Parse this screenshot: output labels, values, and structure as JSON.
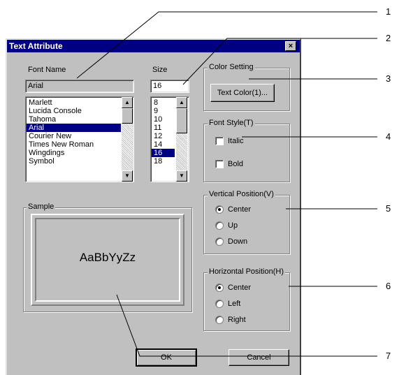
{
  "dialog": {
    "title": "Text Attribute",
    "close_glyph": "×"
  },
  "font_name": {
    "label": "Font Name",
    "value": "Arial",
    "items": [
      "Marlett",
      "Lucida Console",
      "Tahoma",
      "Arial",
      "Courier New",
      "Times New Roman",
      "Wingdings",
      "Symbol"
    ],
    "selected": "Arial"
  },
  "size": {
    "label": "Size",
    "value": "16",
    "items": [
      "8",
      "9",
      "10",
      "11",
      "12",
      "14",
      "16",
      "18"
    ],
    "selected": "16"
  },
  "color_setting": {
    "title": "Color Setting",
    "button_label": "Text Color(1)..."
  },
  "font_style": {
    "title": "Font Style(T)",
    "italic_label": "Italic",
    "bold_label": "Bold",
    "italic_checked": false,
    "bold_checked": false
  },
  "vertical_position": {
    "title": "Vertical Position(V)",
    "options": [
      "Center",
      "Up",
      "Down"
    ],
    "selected": "Center"
  },
  "horizontal_position": {
    "title": "Horizontal Position(H)",
    "options": [
      "Center",
      "Left",
      "Right"
    ],
    "selected": "Center"
  },
  "sample": {
    "title": "Sample",
    "text": "AaBbYyZz"
  },
  "buttons": {
    "ok": "OK",
    "cancel": "Cancel"
  },
  "callouts": [
    "1",
    "2",
    "3",
    "4",
    "5",
    "6",
    "7"
  ],
  "colors": {
    "dialog_bg": "#c0c0c0",
    "title_bar": "#000080",
    "selection": "#000080"
  }
}
